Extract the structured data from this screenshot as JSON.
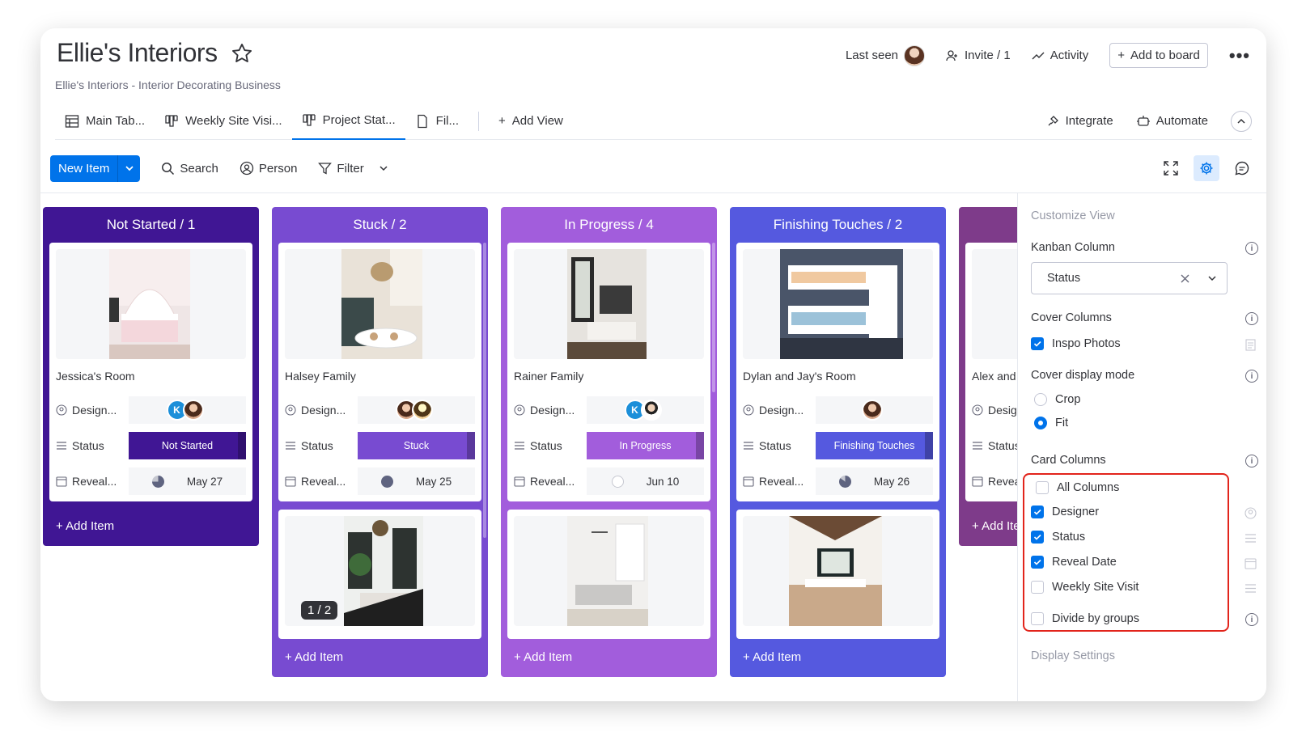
{
  "header": {
    "title": "Ellie's Interiors",
    "subtitle": "Ellie's Interiors - Interior Decorating Business",
    "last_seen": "Last seen",
    "invite": "Invite / 1",
    "activity": "Activity",
    "add_to_board": "Add to board",
    "more": "•••"
  },
  "tabs": {
    "items": [
      {
        "label": "Main Tab..."
      },
      {
        "label": "Weekly Site Visi..."
      },
      {
        "label": "Project Stat..."
      },
      {
        "label": "Fil..."
      }
    ],
    "add_view": "Add View",
    "integrate": "Integrate",
    "automate": "Automate"
  },
  "toolbar": {
    "new_item": "New Item",
    "search": "Search",
    "person": "Person",
    "filter": "Filter"
  },
  "columns": [
    {
      "title": "Not Started / 1",
      "color": "#401694",
      "add_item": "+ Add Item"
    },
    {
      "title": "Stuck / 2",
      "color": "#784bd1",
      "add_item": "+ Add Item"
    },
    {
      "title": "In Progress / 4",
      "color": "#a25ddc",
      "add_item": "+ Add Item"
    },
    {
      "title": "Finishing Touches / 2",
      "color": "#5559df",
      "add_item": "+ Add Item"
    },
    {
      "title": "",
      "color": "#7e3b8a",
      "add_item": "+ Add Ite"
    }
  ],
  "cards": {
    "c0": {
      "name": "Jessica's Room",
      "status": "Not Started",
      "date": "May 27"
    },
    "c1": {
      "name": "Halsey Family",
      "status": "Stuck",
      "date": "May 25"
    },
    "c2": {
      "name": "Rainer Family",
      "status": "In Progress",
      "date": "Jun 10"
    },
    "c3": {
      "name": "Dylan and Jay's Room",
      "status": "Finishing Touches",
      "date": "May 26"
    },
    "c4": {
      "name": "Alex and ",
      "status": "",
      "date": ""
    },
    "c1b": {
      "counter": "1 / 2"
    }
  },
  "card_labels": {
    "designer": "Design...",
    "status": "Status",
    "reveal": "Reveal...",
    "k": "K"
  },
  "partial_labels": {
    "designer": "Desig",
    "status": "Status",
    "reveal": "Revea"
  },
  "panel": {
    "title": "Customize View",
    "kanban_column": "Kanban Column",
    "kanban_value": "Status",
    "cover_columns": "Cover Columns",
    "inspo_photos": "Inspo Photos",
    "cover_display_mode": "Cover display mode",
    "crop": "Crop",
    "fit": "Fit",
    "card_columns": "Card Columns",
    "all_columns": "All Columns",
    "designer": "Designer",
    "status": "Status",
    "reveal_date": "Reveal Date",
    "weekly_site_visit": "Weekly Site Visit",
    "divide_by_groups": "Divide by groups",
    "display_settings": "Display Settings",
    "info": "i"
  },
  "colors": {
    "accent": "#0073ea",
    "highlight": "#e2241b"
  }
}
